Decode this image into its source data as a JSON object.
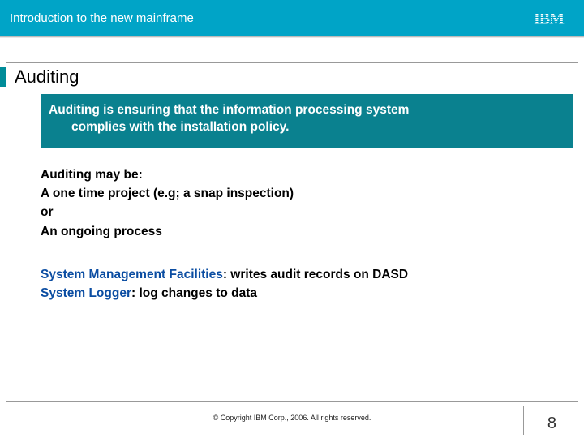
{
  "header": {
    "title": "Introduction to the new mainframe",
    "logo_label": "IBM"
  },
  "page": {
    "title": "Auditing",
    "definition_line1": "Auditing is  ensuring that the information processing system",
    "definition_line2": "complies with the installation policy.",
    "maybe_intro": "Auditing may be:",
    "maybe_line1": "A one time project  (e.g; a snap inspection)",
    "maybe_or": "or",
    "maybe_line2": "An ongoing process",
    "smf_label": "System Management Facilities",
    "smf_desc": ": writes audit records on DASD",
    "logger_label": "System Logger",
    "logger_desc": ": log changes to data"
  },
  "footer": {
    "copyright": "© Copyright IBM Corp., 2006. All rights reserved.",
    "page_number": "8"
  }
}
